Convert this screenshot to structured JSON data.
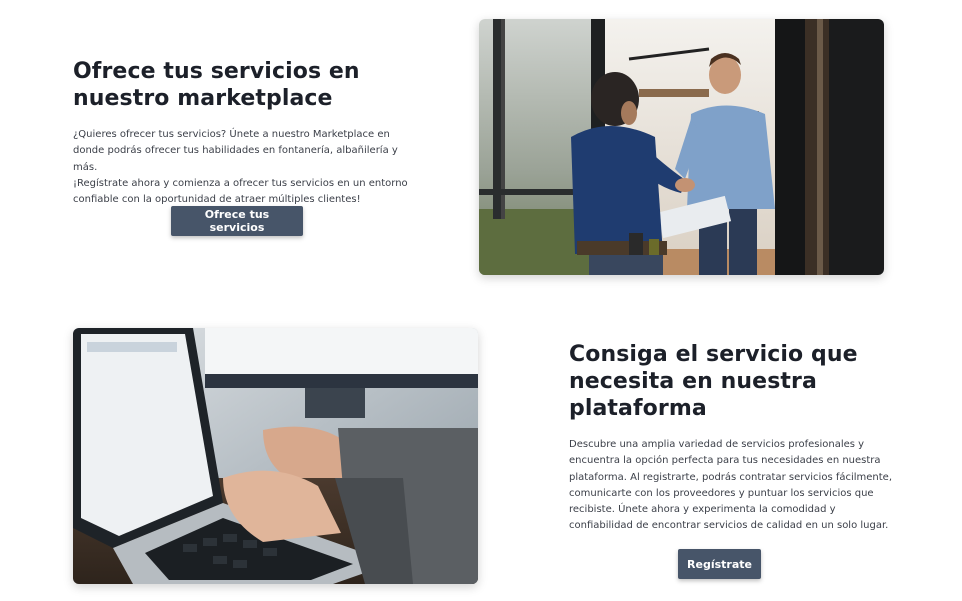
{
  "section_one": {
    "title_line1": "Ofrece tus servicios en",
    "title_line2": "nuestro marketplace",
    "paragraph_lines": [
      "¿Quieres ofrecer tus servicios? Únete a nuestro Marketplace en",
      "donde podrás ofrecer tus habilidades en fontanería, albañilería y más.",
      "¡Regístrate ahora y comienza a ofrecer tus servicios en un entorno",
      "confiable con la oportunidad de atraer múltiples clientes!"
    ],
    "button_label": "Ofrece tus servicios"
  },
  "section_two": {
    "title_line1": "Consiga el servicio que",
    "title_line2": "necesita en nuestra",
    "title_line3": "plataforma",
    "paragraph_lines": [
      "Descubre una amplia variedad de servicios profesionales y",
      "encuentra la opción perfecta para tus necesidades en nuestra",
      "plataforma. Al registrarte, podrás contratar servicios fácilmente,",
      "comunicarte con los proveedores y puntuar los servicios que",
      "recibiste. Únete ahora y experimenta la comodidad y",
      "confiabilidad de encontrar servicios de calidad en un solo lugar."
    ],
    "button_label": "Regístrate"
  },
  "colors": {
    "button_bg": "#475569",
    "heading": "#1c2029",
    "body_text": "#3b3f48"
  }
}
